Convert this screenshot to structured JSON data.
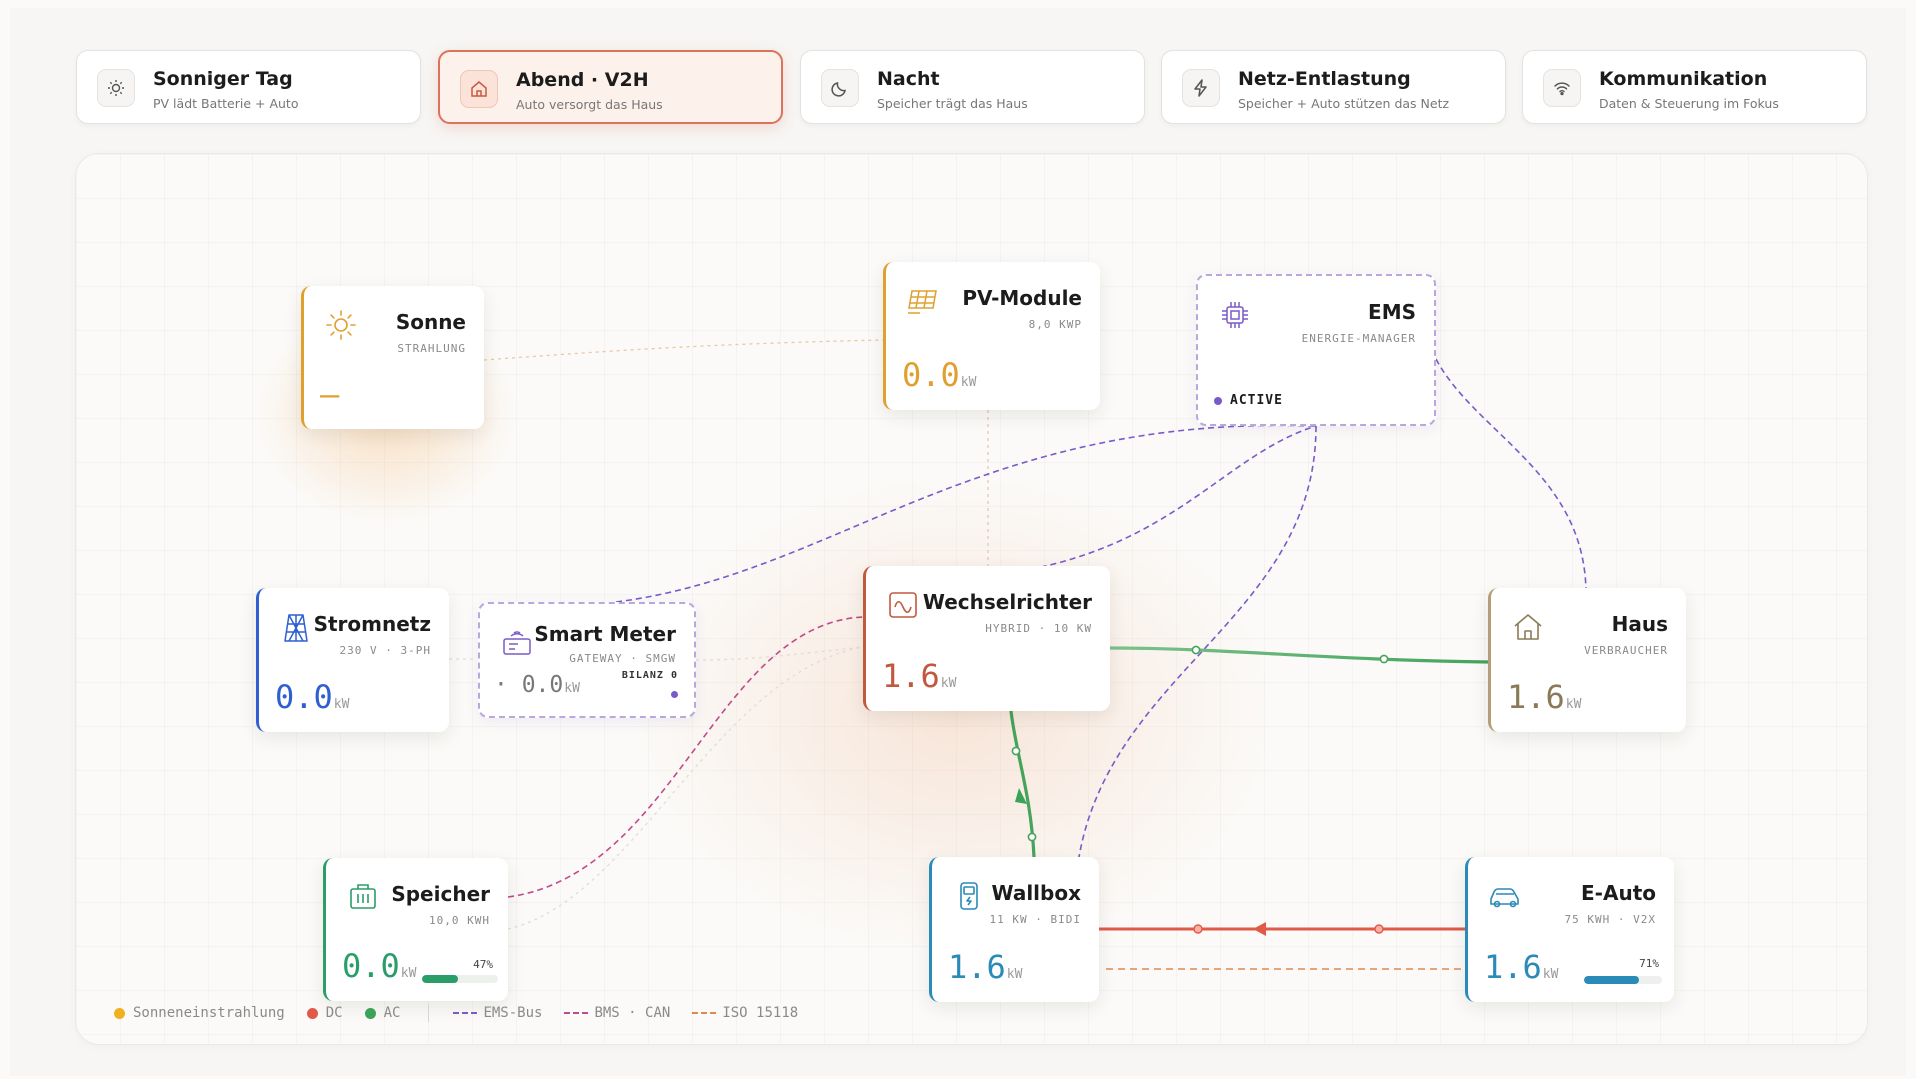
{
  "colors": {
    "accent": "#d9735c",
    "sun": "#e0a030",
    "dc": "#e05a48",
    "ac": "#3aa357",
    "ems_bus": "#7a5ac8",
    "bms_can": "#c04a8a",
    "iso15118": "#e08850",
    "grid": "#2f5fd0",
    "storage": "#2a9d68",
    "inverter": "#c2583e",
    "house": "#8a7a58",
    "wallbox": "#2a8ab8",
    "ev": "#2a8ab8"
  },
  "tabs": [
    {
      "title": "Sonniger Tag",
      "subtitle": "PV lädt Batterie + Auto",
      "icon": "sun-icon",
      "active": false
    },
    {
      "title": "Abend · V2H",
      "subtitle": "Auto versorgt das Haus",
      "icon": "home-icon",
      "active": true
    },
    {
      "title": "Nacht",
      "subtitle": "Speicher trägt das Haus",
      "icon": "moon-icon",
      "active": false
    },
    {
      "title": "Netz-Entlastung",
      "subtitle": "Speicher + Auto stützen das Netz",
      "icon": "bolt-icon",
      "active": false
    },
    {
      "title": "Kommunikation",
      "subtitle": "Daten & Steuerung im Fokus",
      "icon": "wifi-icon",
      "active": false
    }
  ],
  "nodes": {
    "sonne": {
      "title": "Sonne",
      "subtitle": "STRAHLUNG",
      "value": "–",
      "icon": "sun-icon"
    },
    "pv": {
      "title": "PV-Module",
      "subtitle": "8,0 KWP",
      "value": "0.0",
      "unit": "kW",
      "icon": "solar-panel-icon"
    },
    "ems": {
      "title": "EMS",
      "subtitle": "ENERGIE-MANAGER",
      "status": "ACTIVE",
      "icon": "chip-icon"
    },
    "grid": {
      "title": "Stromnetz",
      "subtitle": "230 V · 3-PH",
      "value": "0.0",
      "unit": "kW",
      "icon": "pylon-icon"
    },
    "meter": {
      "title": "Smart Meter",
      "subtitle": "GATEWAY · SMGW",
      "value": "· 0.0",
      "unit": "kW",
      "tag": "BILANZ 0",
      "icon": "meter-icon"
    },
    "inverter": {
      "title": "Wechselrichter",
      "subtitle": "HYBRID · 10 KW",
      "value": "1.6",
      "unit": "kW",
      "icon": "inverter-icon"
    },
    "house": {
      "title": "Haus",
      "subtitle": "VERBRAUCHER",
      "value": "1.6",
      "unit": "kW",
      "icon": "house-icon"
    },
    "storage": {
      "title": "Speicher",
      "subtitle": "10,0 KWH",
      "value": "0.0",
      "unit": "kW",
      "soc": 47,
      "soc_label": "47%",
      "icon": "battery-icon"
    },
    "wallbox": {
      "title": "Wallbox",
      "subtitle": "11 KW · BIDI",
      "value": "1.6",
      "unit": "kW",
      "icon": "charger-icon"
    },
    "ev": {
      "title": "E-Auto",
      "subtitle": "75 KWH · V2X",
      "value": "1.6",
      "unit": "kW",
      "soc": 71,
      "soc_label": "71%",
      "icon": "car-icon"
    }
  },
  "legend": {
    "sun": "Sonneneinstrahlung",
    "dc": "DC",
    "ac": "AC",
    "ems_bus": "EMS-Bus",
    "bms_can": "BMS · CAN",
    "iso": "ISO 15118"
  }
}
